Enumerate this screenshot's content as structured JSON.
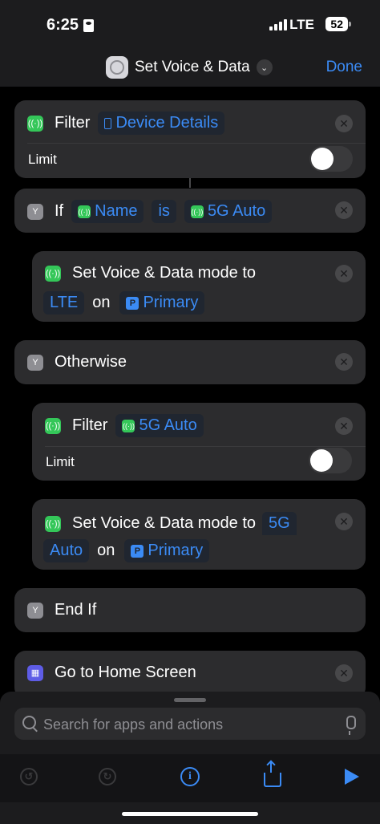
{
  "status": {
    "time": "6:25",
    "network": "LTE",
    "battery": "52"
  },
  "nav": {
    "title": "Set Voice & Data",
    "done_label": "Done"
  },
  "actions": {
    "filter1": {
      "label": "Filter",
      "token": "Device Details",
      "limit_label": "Limit"
    },
    "if": {
      "label": "If",
      "token_name": "Name",
      "op": "is",
      "token_value": "5G Auto"
    },
    "set1": {
      "text": "Set Voice & Data mode to",
      "mode": "LTE",
      "on": "on",
      "line": "Primary"
    },
    "otherwise": {
      "label": "Otherwise"
    },
    "filter2": {
      "label": "Filter",
      "token": "5G Auto",
      "limit_label": "Limit"
    },
    "set2": {
      "text": "Set Voice & Data mode to",
      "mode_a": "5G",
      "mode_b": "Auto",
      "on": "on",
      "line": "Primary"
    },
    "endif": {
      "label": "End If"
    },
    "home": {
      "label": "Go to Home Screen"
    }
  },
  "search": {
    "placeholder": "Search for apps and actions"
  },
  "icons": {
    "cellular": "antenna-icon",
    "branch": "branch-icon",
    "grid": "app-grid-icon",
    "remove": "close-icon"
  },
  "colors": {
    "accent": "#3b8bf5",
    "card": "#2c2c2e",
    "green": "#34c759"
  }
}
